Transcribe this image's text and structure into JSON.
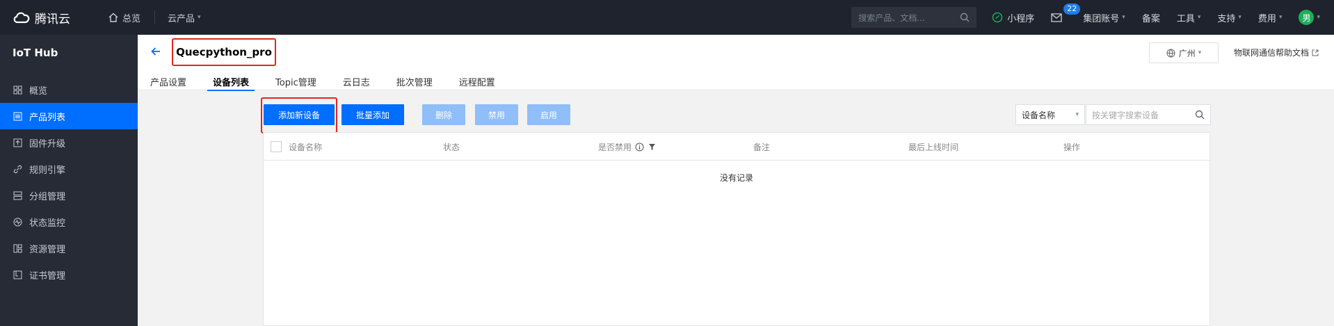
{
  "topbar": {
    "brand": "腾讯云",
    "home": "总览",
    "products": "云产品",
    "search_placeholder": "搜索产品、文档...",
    "miniprogram": "小程序",
    "mail_count": "22",
    "group_account": "集团账号",
    "beian": "备案",
    "tools": "工具",
    "support": "支持",
    "billing": "费用",
    "avatar": "男"
  },
  "sidebar": {
    "title": "IoT Hub",
    "items": [
      {
        "label": "概览"
      },
      {
        "label": "产品列表"
      },
      {
        "label": "固件升级"
      },
      {
        "label": "规则引擎"
      },
      {
        "label": "分组管理"
      },
      {
        "label": "状态监控"
      },
      {
        "label": "资源管理"
      },
      {
        "label": "证书管理"
      }
    ]
  },
  "header": {
    "product_name": "Quecpython_pro",
    "tabs": [
      {
        "label": "产品设置"
      },
      {
        "label": "设备列表"
      },
      {
        "label": "Topic管理"
      },
      {
        "label": "云日志"
      },
      {
        "label": "批次管理"
      },
      {
        "label": "远程配置"
      }
    ],
    "region": "广州",
    "help": "物联网通信帮助文档"
  },
  "toolbar": {
    "add_device": "添加新设备",
    "batch_add": "批量添加",
    "delete": "删除",
    "disable": "禁用",
    "enable": "启用",
    "filter_field": "设备名称",
    "filter_placeholder": "按关键字搜索设备"
  },
  "table": {
    "columns": [
      "设备名称",
      "状态",
      "是否禁用",
      "备注",
      "最后上线时间",
      "操作"
    ],
    "empty_text": "没有记录"
  },
  "colors": {
    "accent": "#006eff",
    "topbar": "#1f232d",
    "sidebar": "#272b36",
    "highlight": "#e2261b"
  }
}
